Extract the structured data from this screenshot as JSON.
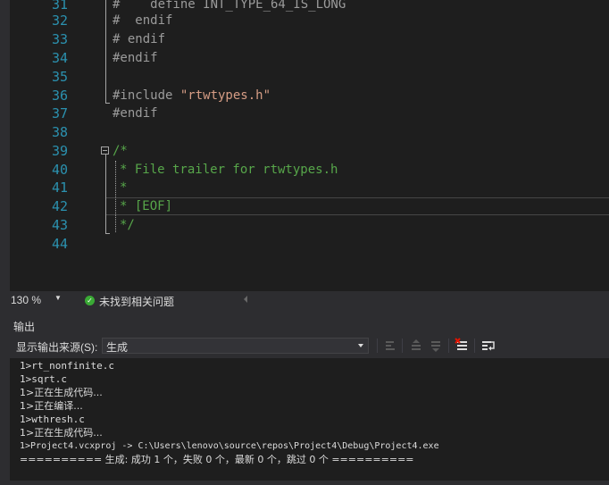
{
  "editor": {
    "line_numbers": [
      "31",
      "32",
      "33",
      "34",
      "35",
      "36",
      "37",
      "38",
      "39",
      "40",
      "41",
      "42",
      "43",
      "44"
    ],
    "lines": {
      "l31": "#    define INT_TYPE_64_IS_LONG",
      "l32": "#  endif",
      "l33": "# endif",
      "l34": "#endif",
      "l36_directive": "#include ",
      "l36_string": "\"rtwtypes.h\"",
      "l37": "#endif",
      "l39": "/*",
      "l40": "* File trailer for rtwtypes.h",
      "l41": "*",
      "l42": "* [EOF]",
      "l43": "*/"
    },
    "colors": {
      "line_number": "#2b91af",
      "preprocessor": "#9b9b9b",
      "string": "#d69d85",
      "comment": "#57a64a"
    }
  },
  "editor_status": {
    "zoom": "130 %",
    "issues": "未找到相关问题"
  },
  "output": {
    "title": "输出",
    "source_label": "显示输出来源(S):",
    "source_value": "生成",
    "lines": [
      "1>rt_nonfinite.c",
      "1>sqrt.c",
      "1>正在生成代码...",
      "1>正在编译...",
      "1>wthresh.c",
      "1>正在生成代码...",
      "1>Project4.vcxproj -> C:\\Users\\lenovo\\source\\repos\\Project4\\Debug\\Project4.exe",
      "========== 生成: 成功 1 个，失败 0 个，最新 0 个，跳过 0 个 =========="
    ]
  }
}
